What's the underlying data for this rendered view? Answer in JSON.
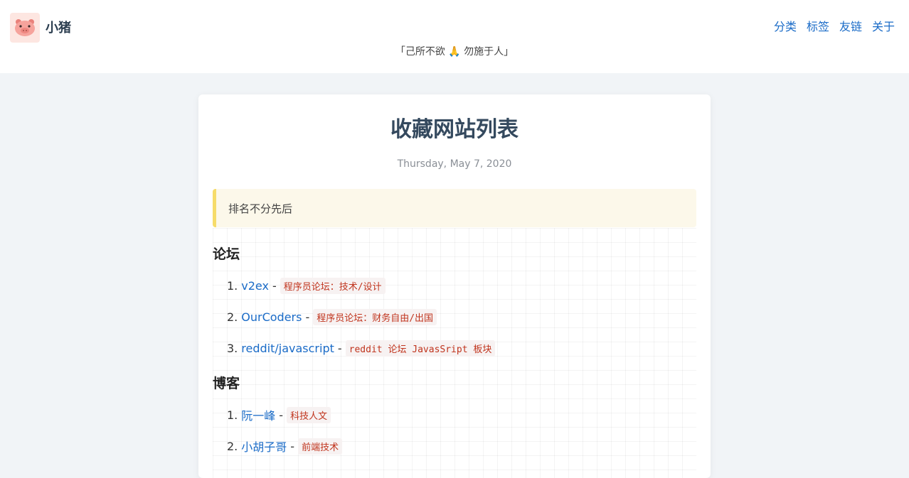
{
  "header": {
    "site_name": "小猪",
    "logo_icon": "pig-face-icon",
    "slogan": "「己所不欲 🙏 勿施于人」",
    "nav": [
      "分类",
      "标签",
      "友链",
      "关于"
    ]
  },
  "post": {
    "title": "收藏网站列表",
    "date": "Thursday, May 7, 2020",
    "notice": "排名不分先后"
  },
  "sections": [
    {
      "heading": "论坛",
      "items": [
        {
          "num": "1.",
          "link": "v2ex",
          "desc": "程序员论坛：技术/设计"
        },
        {
          "num": "2.",
          "link": "OurCoders",
          "desc": "程序员论坛：财务自由/出国"
        },
        {
          "num": "3.",
          "link": "reddit/javascript",
          "desc": "reddit 论坛 JavasSript 板块"
        }
      ]
    },
    {
      "heading": "博客",
      "items": [
        {
          "num": "1.",
          "link": "阮一峰",
          "desc": "科技人文"
        },
        {
          "num": "2.",
          "link": "小胡子哥",
          "desc": "前端技术"
        }
      ]
    }
  ],
  "colors": {
    "link": "#1a6bc7",
    "code": "#c0341d",
    "notice_border": "#f6dc6a",
    "notice_bg": "#fcf8ea",
    "page_bg": "#f1f4f7"
  }
}
